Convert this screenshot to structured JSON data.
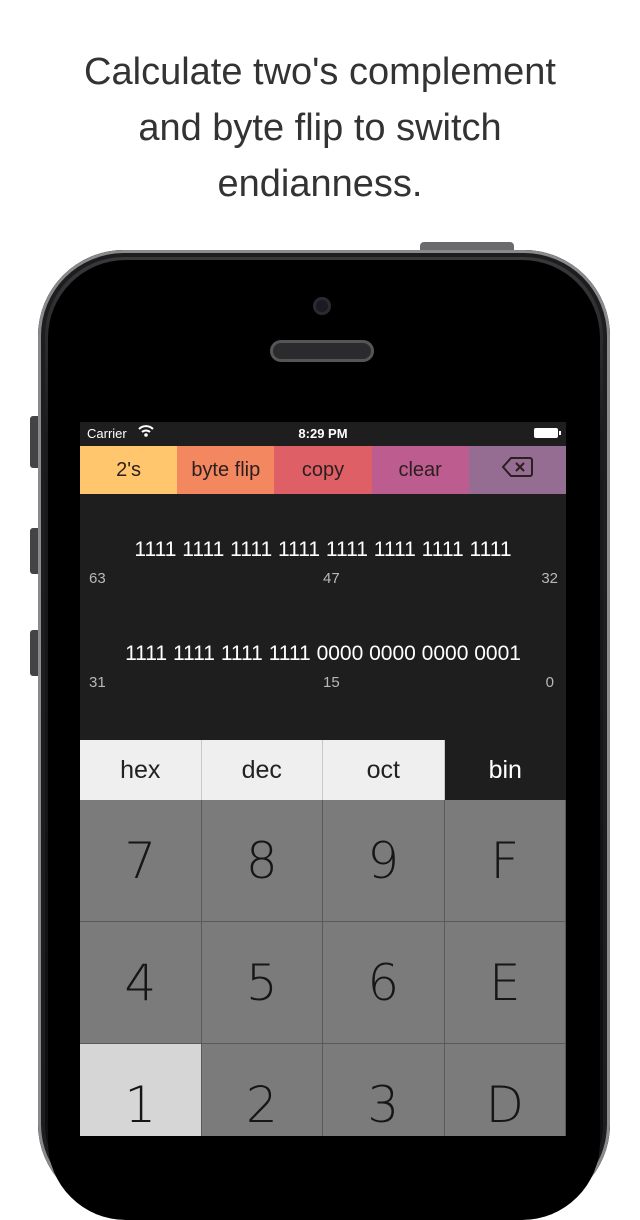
{
  "headline": {
    "line1": "Calculate two's complement",
    "line2": "and byte flip to switch",
    "line3": "endianness."
  },
  "statusbar": {
    "carrier": "Carrier",
    "wifi_icon": "wifi-icon",
    "time": "8:29 PM",
    "battery_icon": "battery-icon"
  },
  "toolbar": {
    "twos_label": "2's",
    "byteflip_label": "byte flip",
    "copy_label": "copy",
    "clear_label": "clear",
    "backspace_icon": "backspace-icon",
    "colors": [
      "#ffc66d",
      "#f3875f",
      "#df5f66",
      "#bd5c8e",
      "#956d92"
    ]
  },
  "bits": {
    "upper": {
      "value": "1111 1111 1111 1111 1111 1111 1111 1111",
      "idx_left": "63",
      "idx_mid": "47",
      "idx_right": "32"
    },
    "lower": {
      "value": "1111 1111 1111 1111 0000 0000 0000 0001",
      "idx_left": "31",
      "idx_mid": "15",
      "idx_right": "0"
    }
  },
  "modes": {
    "hex": "hex",
    "dec": "dec",
    "oct": "oct",
    "bin": "bin",
    "selected": "bin"
  },
  "keypad": {
    "row1": [
      "7",
      "8",
      "9",
      "F"
    ],
    "row2": [
      "4",
      "5",
      "6",
      "E"
    ],
    "row3": [
      "1",
      "2",
      "3",
      "D"
    ]
  }
}
